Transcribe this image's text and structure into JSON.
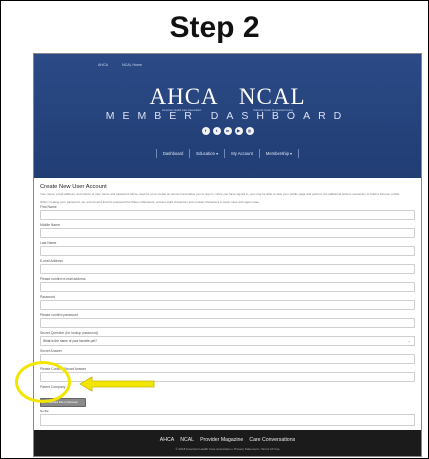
{
  "heading": "Step 2",
  "top_nav": [
    "AHCA",
    "NCAL Home"
  ],
  "brand": {
    "ahca": "AHCA",
    "ncal": "NCAL",
    "ahca_tagline": "American Health Care Association",
    "ncal_tagline": "National Center for Assisted Living",
    "dashboard": "MEMBER DASHBOARD"
  },
  "social_icons": [
    "facebook-icon",
    "twitter-icon",
    "linkedin-icon",
    "youtube-icon",
    "instagram-icon"
  ],
  "tabs": [
    "Dashboard",
    "Education ▾",
    "My Account",
    "Membership ▾"
  ],
  "form": {
    "title": "Create New User Account",
    "intro": "Your name, email address, and choice of user name and password will be used for us to create an account and allow you to sign in. Once you have signed in, you may be able to view your profile page and perform the additional actions necessary to build a full user profile.",
    "pw_note": "When creating your password, we recommend that the password be fifteen characters, at least eight characters and contain characters in lower case and upper case.",
    "fields": {
      "first_name": "First Name",
      "middle_name": "Middle Name",
      "last_name": "Last Name",
      "email": "E-mail Address",
      "confirm_email": "Please confirm e-mail address",
      "password": "Password",
      "confirm_password": "Please confirm password",
      "security_question": "Secret Question (for lookup password)",
      "security_answer": "Secret Answer",
      "confirm_answer": "Please Confirm Secret Answer",
      "company": "Parent Company"
    },
    "security_question_value": "What is the name of your favorite pet?",
    "upload_label": "Upload File (Optional)",
    "nofile_text": "No file",
    "submit_label": "Create Account and Submit"
  },
  "footer": {
    "links": [
      "AHCA",
      "NCAL",
      "Provider Magazine",
      "Care Conversations"
    ],
    "copyright": "© 2018 American Health Care Association • Privacy Statement • Terms Of Use"
  },
  "annotation_color": "#f2e600"
}
